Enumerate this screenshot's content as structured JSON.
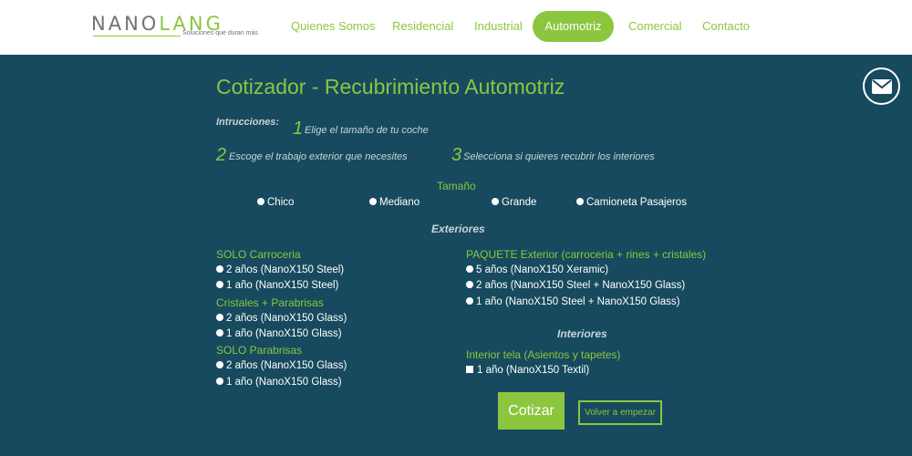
{
  "header": {
    "logo": {
      "text_a": "NANO",
      "text_b": "LANG",
      "tagline": "Soluciones que duran más"
    },
    "nav": [
      {
        "label": "Quienes Somos"
      },
      {
        "label": "Residencial"
      },
      {
        "label": "Industrial"
      },
      {
        "label": "Automotriz",
        "active": true
      },
      {
        "label": "Comercial"
      },
      {
        "label": "Contacto"
      }
    ]
  },
  "contact_icon": "envelope-icon",
  "main": {
    "title": "Cotizador - Recubrimiento Automotriz",
    "instructions": {
      "label": "Intrucciones:",
      "steps": [
        {
          "num": "1",
          "text": "Elige el tamaño de tu coche"
        },
        {
          "num": "2",
          "text": "Escoge el trabajo exterior que necesites"
        },
        {
          "num": "3",
          "text": "Selecciona si quieres recubrir los interiores"
        }
      ]
    },
    "size": {
      "heading": "Tamaño",
      "options": [
        "Chico",
        "Mediano",
        "Grande",
        "Camioneta Pasajeros"
      ]
    },
    "exteriores": {
      "heading": "Exteriores",
      "groups_left": [
        {
          "title": "SOLO Carroceria",
          "options": [
            "2 años (NanoX150 Steel)",
            "1 año (NanoX150 Steel)"
          ]
        },
        {
          "title": "Cristales + Parabrisas",
          "options": [
            "2 años (NanoX150 Glass)",
            "1 año (NanoX150 Glass)"
          ]
        },
        {
          "title": "SOLO Parabrisas",
          "options": [
            "2 años (NanoX150 Glass)",
            "1 año (NanoX150 Glass)"
          ]
        }
      ],
      "group_right": {
        "title": "PAQUETE Exterior (carroceria + rines + cristales)",
        "options": [
          "5 años (NanoX150 Xeramic)",
          "2 años (NanoX150 Steel + NanoX150 Glass)",
          "1 año (NanoX150 Steel + NanoX150 Glass)"
        ]
      }
    },
    "interiores": {
      "heading": "Interiores",
      "title": "Interior tela (Asientos y tapetes)",
      "option": "1 año (NanoX150 Textil)"
    },
    "buttons": {
      "submit": "Cotizar",
      "reset": "Volver a empezar"
    }
  },
  "colors": {
    "accent": "#8cc63f",
    "background": "#174a5e",
    "header_bg": "#ffffff",
    "muted_text": "#c8d3d8"
  }
}
